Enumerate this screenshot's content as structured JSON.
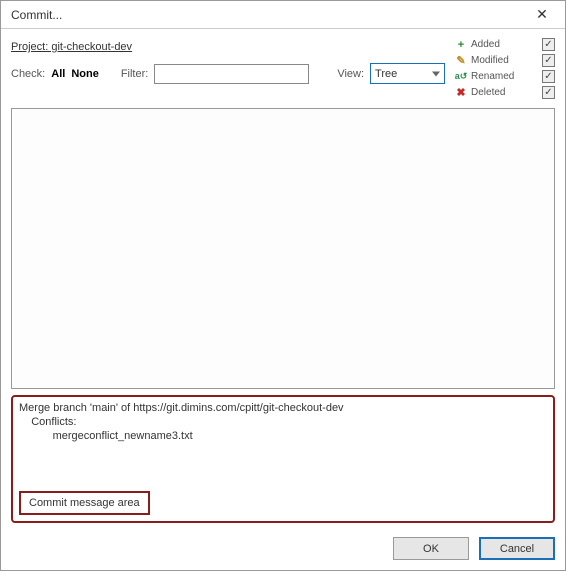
{
  "window": {
    "title": "Commit..."
  },
  "project": {
    "label": "Project: git-checkout-dev"
  },
  "check": {
    "label": "Check:",
    "all": "All",
    "none": "None"
  },
  "filter": {
    "label": "Filter:",
    "value": ""
  },
  "view": {
    "label": "View:",
    "selected": "Tree"
  },
  "legend": {
    "added": "Added",
    "modified": "Modified",
    "renamed": "Renamed",
    "deleted": "Deleted",
    "checkmark": "✓"
  },
  "commit_message": {
    "text": "Merge branch 'main' of https://git.dimins.com/cpitt/git-checkout-dev\n    Conflicts:\n           mergeconflict_newname3.txt",
    "callout": "Commit message area"
  },
  "buttons": {
    "ok": "OK",
    "cancel": "Cancel"
  }
}
